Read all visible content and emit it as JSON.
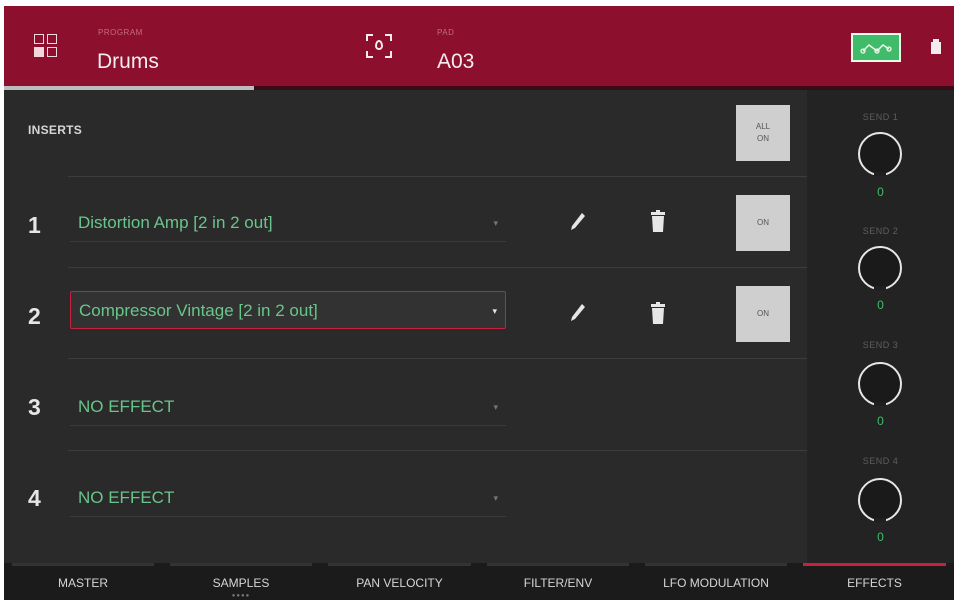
{
  "header": {
    "program_label": "PROGRAM",
    "program_name": "Drums",
    "pad_label": "PAD",
    "pad_value": "A03"
  },
  "inserts": {
    "label": "INSERTS",
    "all_on_label": "ALL\nON",
    "rows": [
      {
        "number": "1",
        "effect": "Distortion Amp [2 in 2 out]",
        "on_label": "ON"
      },
      {
        "number": "2",
        "effect": "Compressor Vintage [2 in 2 out]",
        "on_label": "ON"
      },
      {
        "number": "3",
        "effect": "NO EFFECT"
      },
      {
        "number": "4",
        "effect": "NO EFFECT"
      }
    ]
  },
  "sends": [
    {
      "label": "SEND 1",
      "value": "0"
    },
    {
      "label": "SEND 2",
      "value": "0"
    },
    {
      "label": "SEND 3",
      "value": "0"
    },
    {
      "label": "SEND 4",
      "value": "0"
    }
  ],
  "tabs": [
    "MASTER",
    "SAMPLES",
    "PAN VELOCITY",
    "FILTER/ENV",
    "LFO MODULATION",
    "EFFECTS"
  ],
  "colors": {
    "header_bg": "#8c0f2d",
    "accent_green": "#69c68a",
    "selection_red": "#c8203f",
    "active_tab": "#c8203f"
  }
}
